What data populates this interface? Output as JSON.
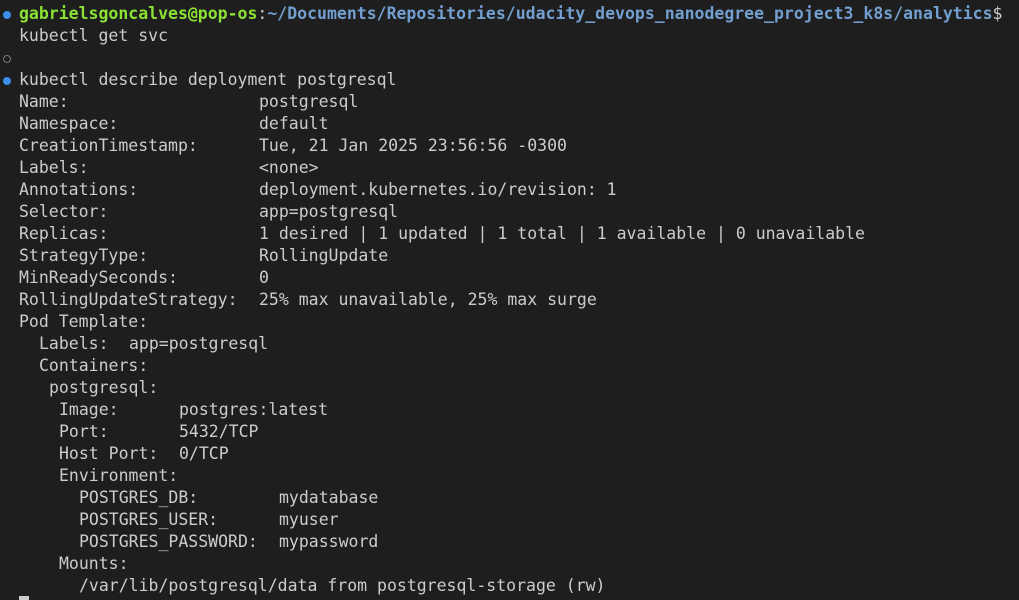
{
  "prompt": {
    "user_host": "gabrielsgoncalves@pop-os",
    "separator": ":",
    "path": "~/Documents/Repositories/udacity_devops_nanodegree_project3_k8s/analytics",
    "symbol": "$"
  },
  "commands": [
    "kubectl get svc",
    "kubectl describe deployment postgresql"
  ],
  "output": {
    "name_label": "Name:",
    "name_value": "postgresql",
    "namespace_label": "Namespace:",
    "namespace_value": "default",
    "created_label": "CreationTimestamp:",
    "created_value": "Tue, 21 Jan 2025 23:56:56 -0300",
    "labels_label": "Labels:",
    "labels_value": "<none>",
    "annotations_label": "Annotations:",
    "annotations_value": "deployment.kubernetes.io/revision: 1",
    "selector_label": "Selector:",
    "selector_value": "app=postgresql",
    "replicas_label": "Replicas:",
    "replicas_value": "1 desired | 1 updated | 1 total | 1 available | 0 unavailable",
    "strategy_label": "StrategyType:",
    "strategy_value": "RollingUpdate",
    "minready_label": "MinReadySeconds:",
    "minready_value": "0",
    "rolling_label": "RollingUpdateStrategy:",
    "rolling_value": "25% max unavailable, 25% max surge",
    "pod_template_label": "Pod Template:",
    "pod_labels_label": "Labels:",
    "pod_labels_value": "app=postgresql",
    "containers_label": "Containers:",
    "container_name": "postgresql:",
    "image_label": "Image:",
    "image_value": "postgres:latest",
    "port_label": "Port:",
    "port_value": "5432/TCP",
    "hostport_label": "Host Port:",
    "hostport_value": "0/TCP",
    "environment_label": "Environment:",
    "env_db_label": "POSTGRES_DB:",
    "env_db_value": "mydatabase",
    "env_user_label": "POSTGRES_USER:",
    "env_user_value": "myuser",
    "env_password_label": "POSTGRES_PASSWORD:",
    "env_password_value": "mypassword",
    "mounts_label": "Mounts:",
    "mounts_value": "/var/lib/postgresql/data from postgresql-storage (rw)"
  }
}
